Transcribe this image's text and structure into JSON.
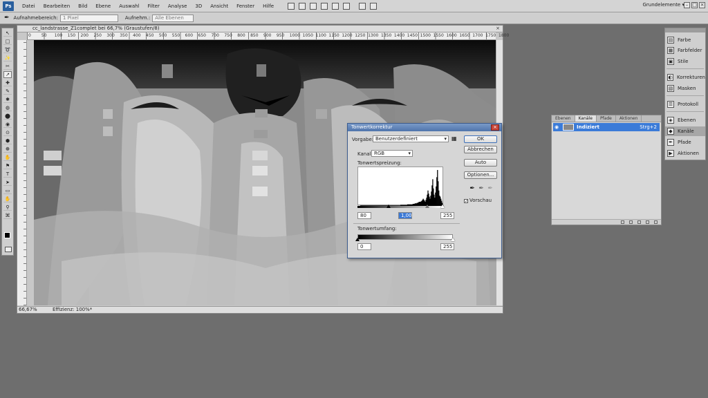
{
  "menubar": {
    "logo": "Ps",
    "items": [
      "Datei",
      "Bearbeiten",
      "Bild",
      "Ebene",
      "Auswahl",
      "Filter",
      "Analyse",
      "3D",
      "Ansicht",
      "Fenster",
      "Hilfe"
    ],
    "workspace": "Grundelemente",
    "workspace_chevron": "▾",
    "minimize": "–",
    "maximize": "□",
    "close": "×"
  },
  "optionsbar": {
    "sample_size_label": "Aufnahmebereich:",
    "sample_size_value": "1 Pixel",
    "sample_label": "Aufnehm.:",
    "sample_value": "Alle Ebenen"
  },
  "toolbox": {
    "tools": [
      "↖",
      "□",
      "➰",
      "✨",
      "✂",
      "↗",
      "✚",
      "✎",
      "✱",
      "◍",
      "⬤",
      "◉",
      "⊙",
      "⬢",
      "❁",
      "✋",
      "⚑",
      "T",
      "➤",
      "▭",
      "✋",
      "⚲",
      "⌘"
    ]
  },
  "document": {
    "title": "cc_landstrasse_Z1complet bei 66,7% (Graustufen/8)",
    "close": "×",
    "zoom": "66,67%",
    "status": "Effizienz: 100%*",
    "ruler_marks": [
      "0",
      "50",
      "100",
      "150",
      "200",
      "250",
      "300",
      "350",
      "400",
      "450",
      "500",
      "550",
      "600",
      "650",
      "700",
      "750",
      "800",
      "850",
      "900",
      "950",
      "1000",
      "1050",
      "1100",
      "1150",
      "1200",
      "1250",
      "1300",
      "1350",
      "1400",
      "1450",
      "1500",
      "1550",
      "1600",
      "1650",
      "1700",
      "1750",
      "1800"
    ]
  },
  "levels": {
    "title": "Tonwertkorrektur",
    "close": "×",
    "preset_label": "Vorgabe:",
    "preset_value": "Benutzerdefiniert",
    "channel_label": "Kanal:",
    "channel_value": "RGB",
    "input_label": "Tonwertspreizung:",
    "input_black": "80",
    "input_gamma": "1,00",
    "input_white": "255",
    "output_label": "Tonwertumfang:",
    "output_black": "0",
    "output_white": "255",
    "btn_ok": "OK",
    "btn_cancel": "Abbrechen",
    "btn_auto": "Auto",
    "btn_options": "Optionen...",
    "preview_label": "Vorschau",
    "preview_checked": true,
    "preview_mark": "✓",
    "eyedropper_glyph": "✒"
  },
  "layers": {
    "tabs": [
      "Ebenen",
      "Kanäle",
      "Pfade",
      "Aktionen"
    ],
    "active_tab": 1,
    "row_eye": "◉",
    "row_name": "Indiziert",
    "row_shortcut": "Strg+2"
  },
  "dock": {
    "items": [
      {
        "icon": "▤",
        "label": "Farbe"
      },
      {
        "icon": "▦",
        "label": "Farbfelder"
      },
      {
        "icon": "▣",
        "label": "Stile"
      },
      {
        "icon": "◐",
        "label": "Korrekturen"
      },
      {
        "icon": "▧",
        "label": "Masken"
      },
      {
        "icon": "☰",
        "label": "Protokoll"
      },
      {
        "icon": "◈",
        "label": "Ebenen"
      },
      {
        "icon": "◆",
        "label": "Kanäle"
      },
      {
        "icon": "✒",
        "label": "Pfade"
      },
      {
        "icon": "▶",
        "label": "Aktionen"
      }
    ],
    "active_item": 7
  },
  "colors": {
    "accent": "#3b7bd8",
    "title_gradient_top": "#7a9ac8",
    "close_red": "#c9463a"
  },
  "histogram": {
    "bins": [
      0,
      0,
      0,
      1,
      1,
      1,
      1,
      1,
      1,
      1,
      1,
      1,
      1,
      1,
      1,
      1,
      1,
      1,
      1,
      1,
      1,
      1,
      1,
      1,
      1,
      1,
      1,
      1,
      1,
      1,
      1,
      1,
      1,
      1,
      1,
      1,
      1,
      1,
      1,
      1,
      1,
      1,
      1,
      1,
      1,
      1,
      1,
      1,
      1,
      1,
      1,
      1,
      1,
      1,
      1,
      1,
      1,
      1,
      1,
      1,
      1,
      1,
      2,
      2,
      2,
      2,
      2,
      2,
      2,
      2,
      2,
      2,
      3,
      3,
      3,
      3,
      3,
      3,
      3,
      3,
      4,
      4,
      4,
      5,
      5,
      5,
      6,
      6,
      7,
      8,
      8,
      8,
      9,
      10,
      12,
      14,
      12,
      10,
      8,
      12,
      16,
      22,
      30,
      24,
      18,
      14,
      20,
      28,
      40,
      52,
      34,
      22,
      16,
      26,
      38,
      56,
      70,
      48,
      30,
      20,
      18,
      14,
      10,
      6,
      2,
      0
    ]
  }
}
